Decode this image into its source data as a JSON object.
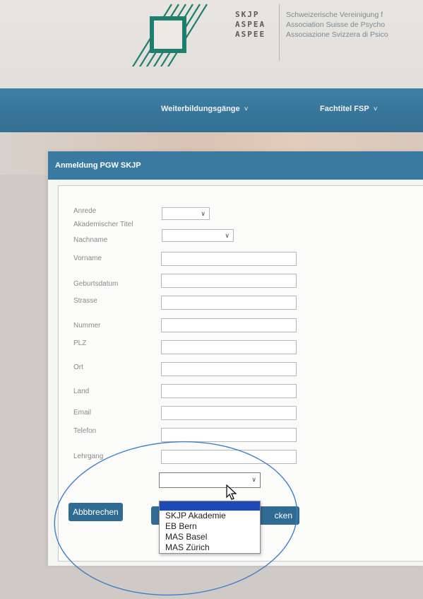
{
  "header": {
    "abbreviations": [
      "SKJP",
      "ASPEA",
      "ASPEE"
    ],
    "association_lines": [
      "Schweizerische Vereinigung f",
      "Association Suisse de Psycho",
      "Associazione Svizzera di Psico"
    ]
  },
  "nav": {
    "items": [
      {
        "label": "Weiterbildungsgänge"
      },
      {
        "label": "Fachtitel FSP"
      }
    ]
  },
  "panel": {
    "title": "Anmeldung PGW SKJP"
  },
  "form": {
    "fields": [
      {
        "label": "Anrede",
        "type": "select",
        "value": ""
      },
      {
        "label": "Akademischer Titel",
        "type": "select",
        "value": ""
      },
      {
        "label": "Nachname",
        "type": "text",
        "value": ""
      },
      {
        "label": "Vorname",
        "type": "text",
        "value": ""
      },
      {
        "label": "Geburtsdatum",
        "type": "text",
        "value": ""
      },
      {
        "label": "Strasse",
        "type": "text",
        "value": ""
      },
      {
        "label": "Nummer",
        "type": "text",
        "value": ""
      },
      {
        "label": "PLZ",
        "type": "text",
        "value": ""
      },
      {
        "label": "Ort",
        "type": "text",
        "value": ""
      },
      {
        "label": "Land",
        "type": "text",
        "value": ""
      },
      {
        "label": "Email",
        "type": "text",
        "value": ""
      },
      {
        "label": "Telefon",
        "type": "text",
        "value": ""
      },
      {
        "label": "Lehrgang",
        "type": "select",
        "value": ""
      }
    ],
    "lehrgang_options": [
      "",
      "SKJP Akademie",
      "EB Bern",
      "MAS Basel",
      "MAS Zürich"
    ],
    "cancel_label": "Abbbrechen",
    "submit_label_visible": "cken"
  },
  "colors": {
    "nav_blue": "#3a7aa0",
    "button_blue": "#2f6b93",
    "highlight_blue": "#1e4bb3",
    "logo_green": "#1f7f6e"
  }
}
